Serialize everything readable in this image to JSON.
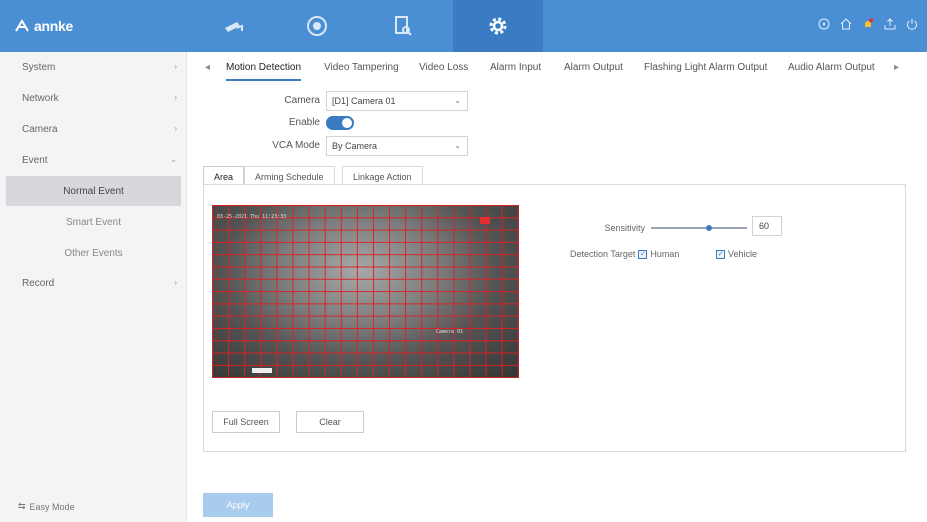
{
  "brand": {
    "name": "annke"
  },
  "topnav": {
    "items": [
      {
        "icon": "camera-nav-icon"
      },
      {
        "icon": "playback-nav-icon"
      },
      {
        "icon": "search-file-nav-icon"
      },
      {
        "icon": "settings-nav-icon",
        "active": true
      }
    ],
    "right_icons": [
      "info-icon",
      "home-icon",
      "notification-bell-icon",
      "export-icon",
      "power-icon"
    ]
  },
  "sidebar": {
    "items": [
      {
        "label": "System"
      },
      {
        "label": "Network"
      },
      {
        "label": "Camera"
      },
      {
        "label": "Event",
        "expanded": true
      },
      {
        "label": "Normal Event",
        "active": true
      },
      {
        "label": "Smart Event"
      },
      {
        "label": "Other Events"
      },
      {
        "label": "Record"
      }
    ],
    "easy_mode": "Easy Mode"
  },
  "tabs": [
    {
      "label": "Motion Detection",
      "active": true
    },
    {
      "label": "Video Tampering"
    },
    {
      "label": "Video Loss"
    },
    {
      "label": "Alarm Input"
    },
    {
      "label": "Alarm Output"
    },
    {
      "label": "Flashing Light Alarm Output"
    },
    {
      "label": "Audio Alarm Output"
    }
  ],
  "form": {
    "camera_label": "Camera",
    "camera_value": "[D1] Camera 01",
    "enable_label": "Enable",
    "enable_on": true,
    "vca_label": "VCA Mode",
    "vca_value": "By Camera"
  },
  "subtabs": [
    {
      "label": "Area",
      "active": true
    },
    {
      "label": "Arming Schedule"
    },
    {
      "label": "Linkage Action"
    }
  ],
  "video": {
    "osd_time": "03-25-2021 Thu 11:23:33",
    "osd_name": "Camera 01"
  },
  "buttons": {
    "full_screen": "Full Screen",
    "clear": "Clear",
    "apply": "Apply"
  },
  "sensitivity": {
    "label": "Sensitivity",
    "value": "60",
    "level": 0.6
  },
  "detection_target": {
    "label": "Detection Target",
    "human": {
      "label": "Human",
      "checked": true
    },
    "vehicle": {
      "label": "Vehicle",
      "checked": true
    }
  },
  "colors": {
    "accent": "#3a7bc4",
    "topbar": "#4a8fd4",
    "grid": "#e02020"
  }
}
